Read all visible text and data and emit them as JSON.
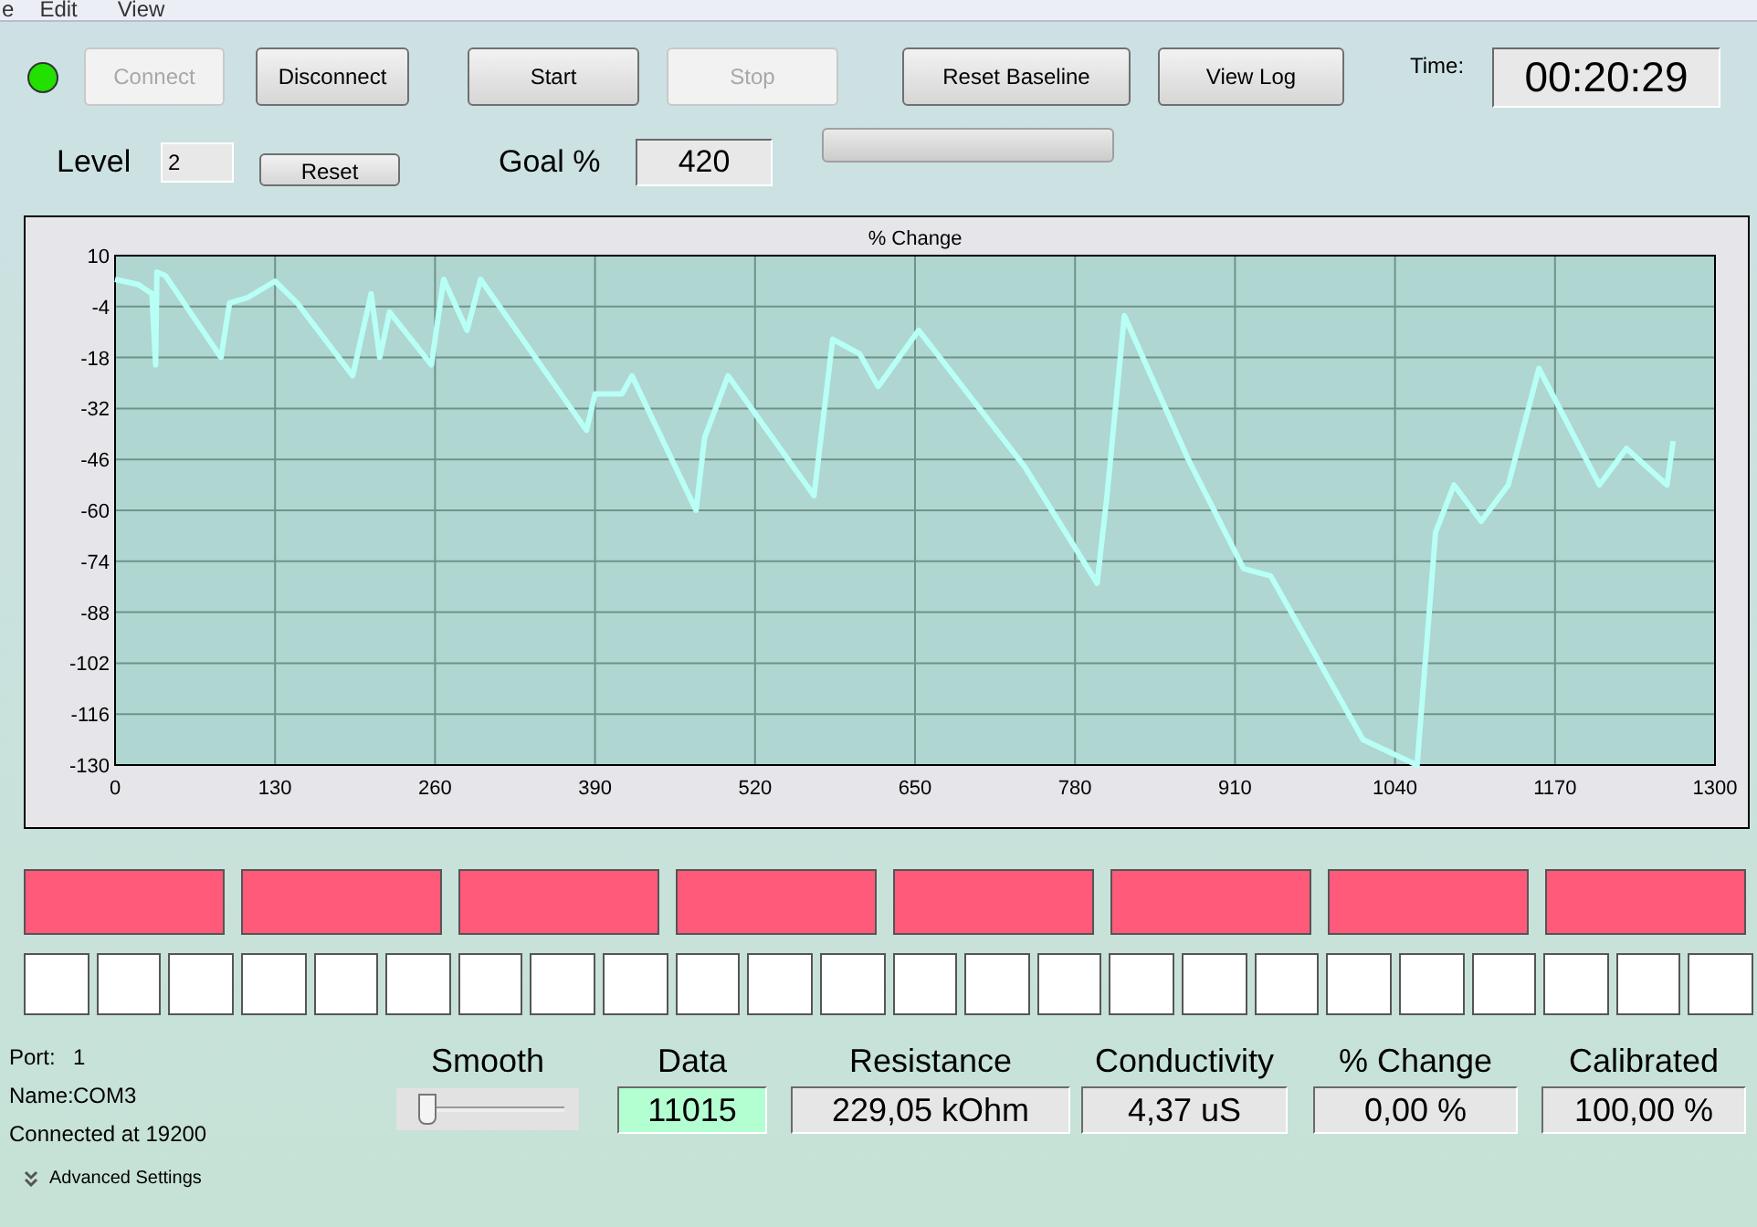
{
  "menu": [
    "e",
    "Edit",
    "View"
  ],
  "status_led": {
    "on": true
  },
  "buttons": [
    {
      "label": "Connect",
      "disabled": true
    },
    {
      "label": "Disconnect",
      "disabled": false
    },
    {
      "label": "Start",
      "disabled": false
    },
    {
      "label": "Stop",
      "disabled": true
    },
    {
      "label": "Reset Baseline",
      "disabled": false
    },
    {
      "label": "View Log",
      "disabled": false
    }
  ],
  "time": {
    "label": "Time:",
    "value": "00:20:29"
  },
  "level": {
    "label": "Level",
    "value": "2",
    "reset_button": "Reset"
  },
  "goal": {
    "label": "Goal %",
    "value": "420",
    "progress": {
      "level": 0
    }
  },
  "chart": {
    "chart_data": {
      "type": "line",
      "title": "% Change",
      "x": [
        0,
        19,
        30,
        33,
        34,
        41,
        86,
        93,
        108,
        130,
        148,
        193,
        208,
        215,
        223,
        257,
        267,
        286,
        297,
        383,
        390,
        412,
        420,
        472,
        479,
        498,
        568,
        583,
        605,
        620,
        653,
        739,
        798,
        806,
        820,
        872,
        917,
        939,
        1014,
        1058,
        1073,
        1088,
        1110,
        1132,
        1157,
        1206,
        1228,
        1261,
        1266
      ],
      "grid": true,
      "values": [
        3.5,
        2,
        -0.5,
        -20,
        5.5,
        4.5,
        -18,
        -3,
        -1.5,
        3,
        -3,
        -23,
        -0.5,
        -18,
        -5.5,
        -20,
        3.5,
        -10.5,
        3.5,
        -38,
        -28,
        -28,
        -23,
        -60,
        -40,
        -23,
        -56,
        -13,
        -17,
        -26,
        -10.5,
        -48,
        -80,
        -56,
        -6.5,
        -46,
        -76,
        -78,
        -123,
        -130,
        -66,
        -53,
        -63,
        -53,
        -21,
        -53,
        -43,
        -53,
        -41
      ],
      "xlim": [
        0,
        1300
      ],
      "ylim": [
        -130,
        10
      ],
      "xticks": [
        0,
        130,
        260,
        390,
        520,
        650,
        780,
        910,
        1040,
        1170,
        1300
      ],
      "yticks": [
        10,
        -4,
        -18,
        -32,
        -46,
        -60,
        -74,
        -88,
        -102,
        -116,
        -130
      ]
    }
  },
  "indicators": [
    {
      "on": true
    },
    {
      "on": true
    },
    {
      "on": true
    },
    {
      "on": true
    },
    {
      "on": true
    },
    {
      "on": true
    },
    {
      "on": true
    },
    {
      "on": true
    }
  ],
  "cells": [
    {
      "on": false
    },
    {
      "on": false
    },
    {
      "on": false
    },
    {
      "on": false
    },
    {
      "on": false
    },
    {
      "on": false
    },
    {
      "on": false
    },
    {
      "on": false
    },
    {
      "on": false
    },
    {
      "on": false
    },
    {
      "on": false
    },
    {
      "on": false
    },
    {
      "on": false
    },
    {
      "on": false
    },
    {
      "on": false
    },
    {
      "on": false
    },
    {
      "on": false
    },
    {
      "on": false
    },
    {
      "on": false
    },
    {
      "on": false
    },
    {
      "on": false
    },
    {
      "on": false
    },
    {
      "on": false
    },
    {
      "on": false
    }
  ],
  "port_info": [
    {
      "label": "Port:",
      "value": "1"
    },
    {
      "label": "Name:",
      "value": "COM3"
    },
    {
      "label": "Connected at 19200"
    }
  ],
  "advanced_settings": "Advanced Settings",
  "metrics": [
    {
      "kind": "slider",
      "label": "Smooth",
      "level": 0.05
    },
    {
      "kind": "readout",
      "label": "Data",
      "value": "11015",
      "highlighted": true
    },
    {
      "kind": "readout",
      "label": "Resistance",
      "value": "229,05 kOhm",
      "highlighted": false
    },
    {
      "kind": "readout",
      "label": "Conductivity",
      "value": "4,37 uS",
      "highlighted": false
    },
    {
      "kind": "readout",
      "label": "% Change",
      "value": "0,00 %",
      "highlighted": false
    },
    {
      "kind": "readout",
      "label": "Calibrated",
      "value": "100,00 %",
      "highlighted": false
    }
  ]
}
